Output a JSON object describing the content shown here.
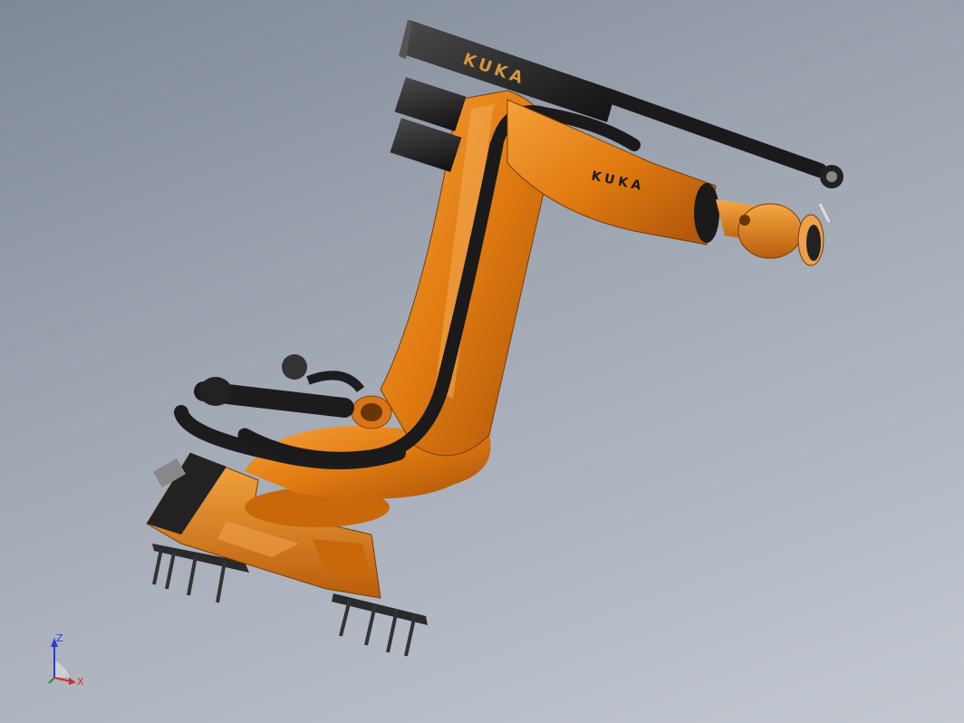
{
  "viewer": {
    "background_top": "#7f8896",
    "background_bottom": "#c3c8d1"
  },
  "model": {
    "robot_color": "#e07a10",
    "cable_color": "#1c1c1c",
    "counterweight_label": "KUKA",
    "arm_label": "KUKA"
  },
  "triad": {
    "z_label": "Z",
    "x_label": "X",
    "z_color": "#2a3bd6",
    "x_color": "#d62a2a"
  }
}
